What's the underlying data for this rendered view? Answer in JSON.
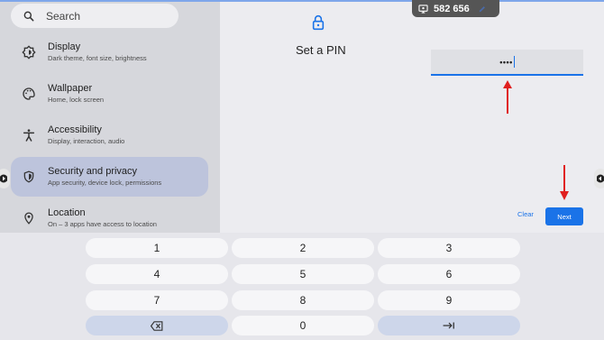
{
  "sidebar": {
    "search_placeholder": "Search",
    "items": [
      {
        "title": "Display",
        "subtitle": "Dark theme, font size, brightness",
        "icon": "display-settings-icon"
      },
      {
        "title": "Wallpaper",
        "subtitle": "Home, lock screen",
        "icon": "palette-icon"
      },
      {
        "title": "Accessibility",
        "subtitle": "Display, interaction, audio",
        "icon": "accessibility-icon"
      },
      {
        "title": "Security and privacy",
        "subtitle": "App security, device lock, permissions",
        "icon": "shield-icon",
        "active": true
      },
      {
        "title": "Location",
        "subtitle": "On – 3 apps have access to location",
        "icon": "location-pin-icon"
      }
    ]
  },
  "main": {
    "title": "Set a PIN",
    "pin_value": "••••",
    "clear_label": "Clear",
    "next_label": "Next"
  },
  "counter": {
    "value": "582 656"
  },
  "keyboard": {
    "keys": [
      "1",
      "2",
      "3",
      "4",
      "5",
      "6",
      "7",
      "8",
      "9",
      "",
      "0",
      ""
    ],
    "backspace_icon": "backspace-icon",
    "tab_icon": "tab-icon"
  },
  "colors": {
    "accent": "#1a73e8",
    "annotation_arrow": "#e02020",
    "sidebar_active": "#bdc4dc"
  }
}
